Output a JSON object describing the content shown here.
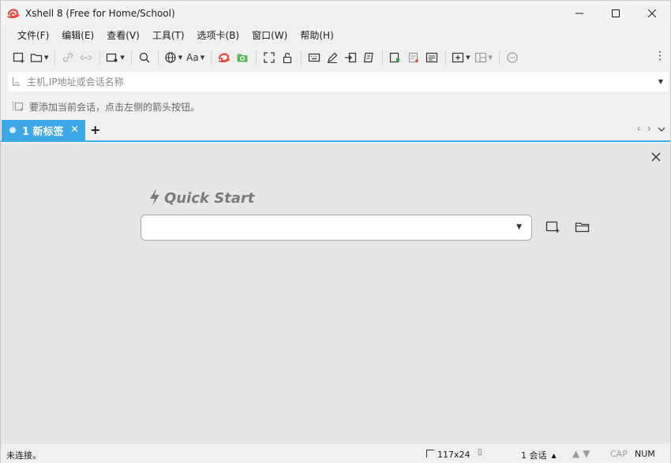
{
  "window": {
    "title": "Xshell 8 (Free for Home/School)",
    "controls": {
      "minimize": "—",
      "maximize": "☐",
      "close": "✕"
    }
  },
  "menu": {
    "items": [
      "文件(F)",
      "编辑(E)",
      "查看(V)",
      "工具(T)",
      "选项卡(B)",
      "窗口(W)",
      "帮助(H)"
    ]
  },
  "toolbar": {
    "font_label": "Aa",
    "more": "⋮"
  },
  "address": {
    "placeholder": "主机,IP地址或会话名称",
    "value": ""
  },
  "hint": {
    "text": "要添加当前会话，点击左侧的箭头按钮。"
  },
  "tabs": {
    "items": [
      {
        "label": "1 新标签",
        "close": "✕",
        "active": true
      }
    ],
    "add": "+",
    "prev": "‹",
    "next": "›",
    "list": "⌄"
  },
  "quick_start": {
    "title": "Quick Start",
    "combo_value": "",
    "close": "✕"
  },
  "status": {
    "left": "未连接。",
    "size": "117x24",
    "term": "▯",
    "sessions": "1 会话",
    "sessions_arrow": "▲",
    "up": "▲",
    "down": "▼",
    "cap": "CAP",
    "num": "NUM"
  },
  "colors": {
    "tab_active": "#3ea7e6",
    "tab_underline": "#3daee9",
    "main_bg": "#e6e6e6",
    "logo": "#e8473c"
  }
}
